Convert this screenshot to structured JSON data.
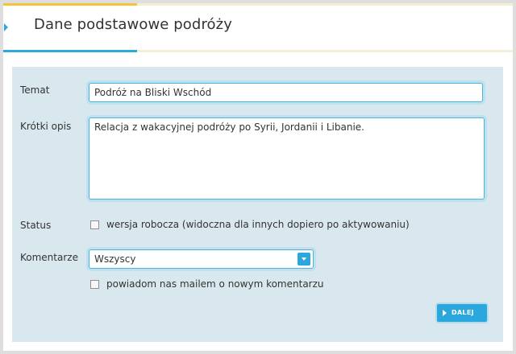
{
  "header": {
    "title": "Dane podstawowe podróży"
  },
  "form": {
    "topic": {
      "label": "Temat",
      "value": "Podróż na Bliski Wschód"
    },
    "description": {
      "label": "Krótki opis",
      "value": "Relacja z wakacyjnej podróży po Syrii, Jordanii i Libanie."
    },
    "status": {
      "label": "Status",
      "checkbox_label": "wersja robocza (widoczna dla innych dopiero po aktywowaniu)",
      "checked": false
    },
    "comments": {
      "label": "Komentarze",
      "selected": "Wszyscy",
      "notify_label": "powiadom nas mailem o nowym komentarzu",
      "notify_checked": false
    },
    "next_button": "DALEJ"
  },
  "colors": {
    "accent": "#29a9de",
    "panel": "#d9e8ef",
    "header_accent": "#f5c23a"
  },
  "icons": {
    "title_marker": "triangle-right-icon",
    "select": "chevron-down-icon",
    "next": "play-icon"
  }
}
